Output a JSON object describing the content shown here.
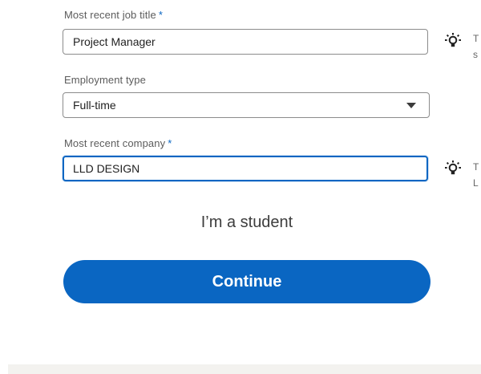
{
  "form": {
    "job_title": {
      "label": "Most recent job title",
      "required_mark": "*",
      "value": "Project Manager",
      "tip_icon": "lightbulb-icon",
      "tip_preview": [
        "T",
        "s"
      ]
    },
    "employment_type": {
      "label": "Employment type",
      "selected": "Full-time",
      "caret_icon": "caret-down-icon"
    },
    "company": {
      "label": "Most recent company",
      "required_mark": "*",
      "value": "LLD DESIGN",
      "tip_icon": "lightbulb-icon",
      "tip_preview": [
        "T",
        "L"
      ]
    },
    "student_link": "I’m a student",
    "continue_label": "Continue"
  },
  "colors": {
    "brand": "#0a66c2",
    "required": "#0a66c2",
    "footer_band": "#f3f2ef"
  }
}
